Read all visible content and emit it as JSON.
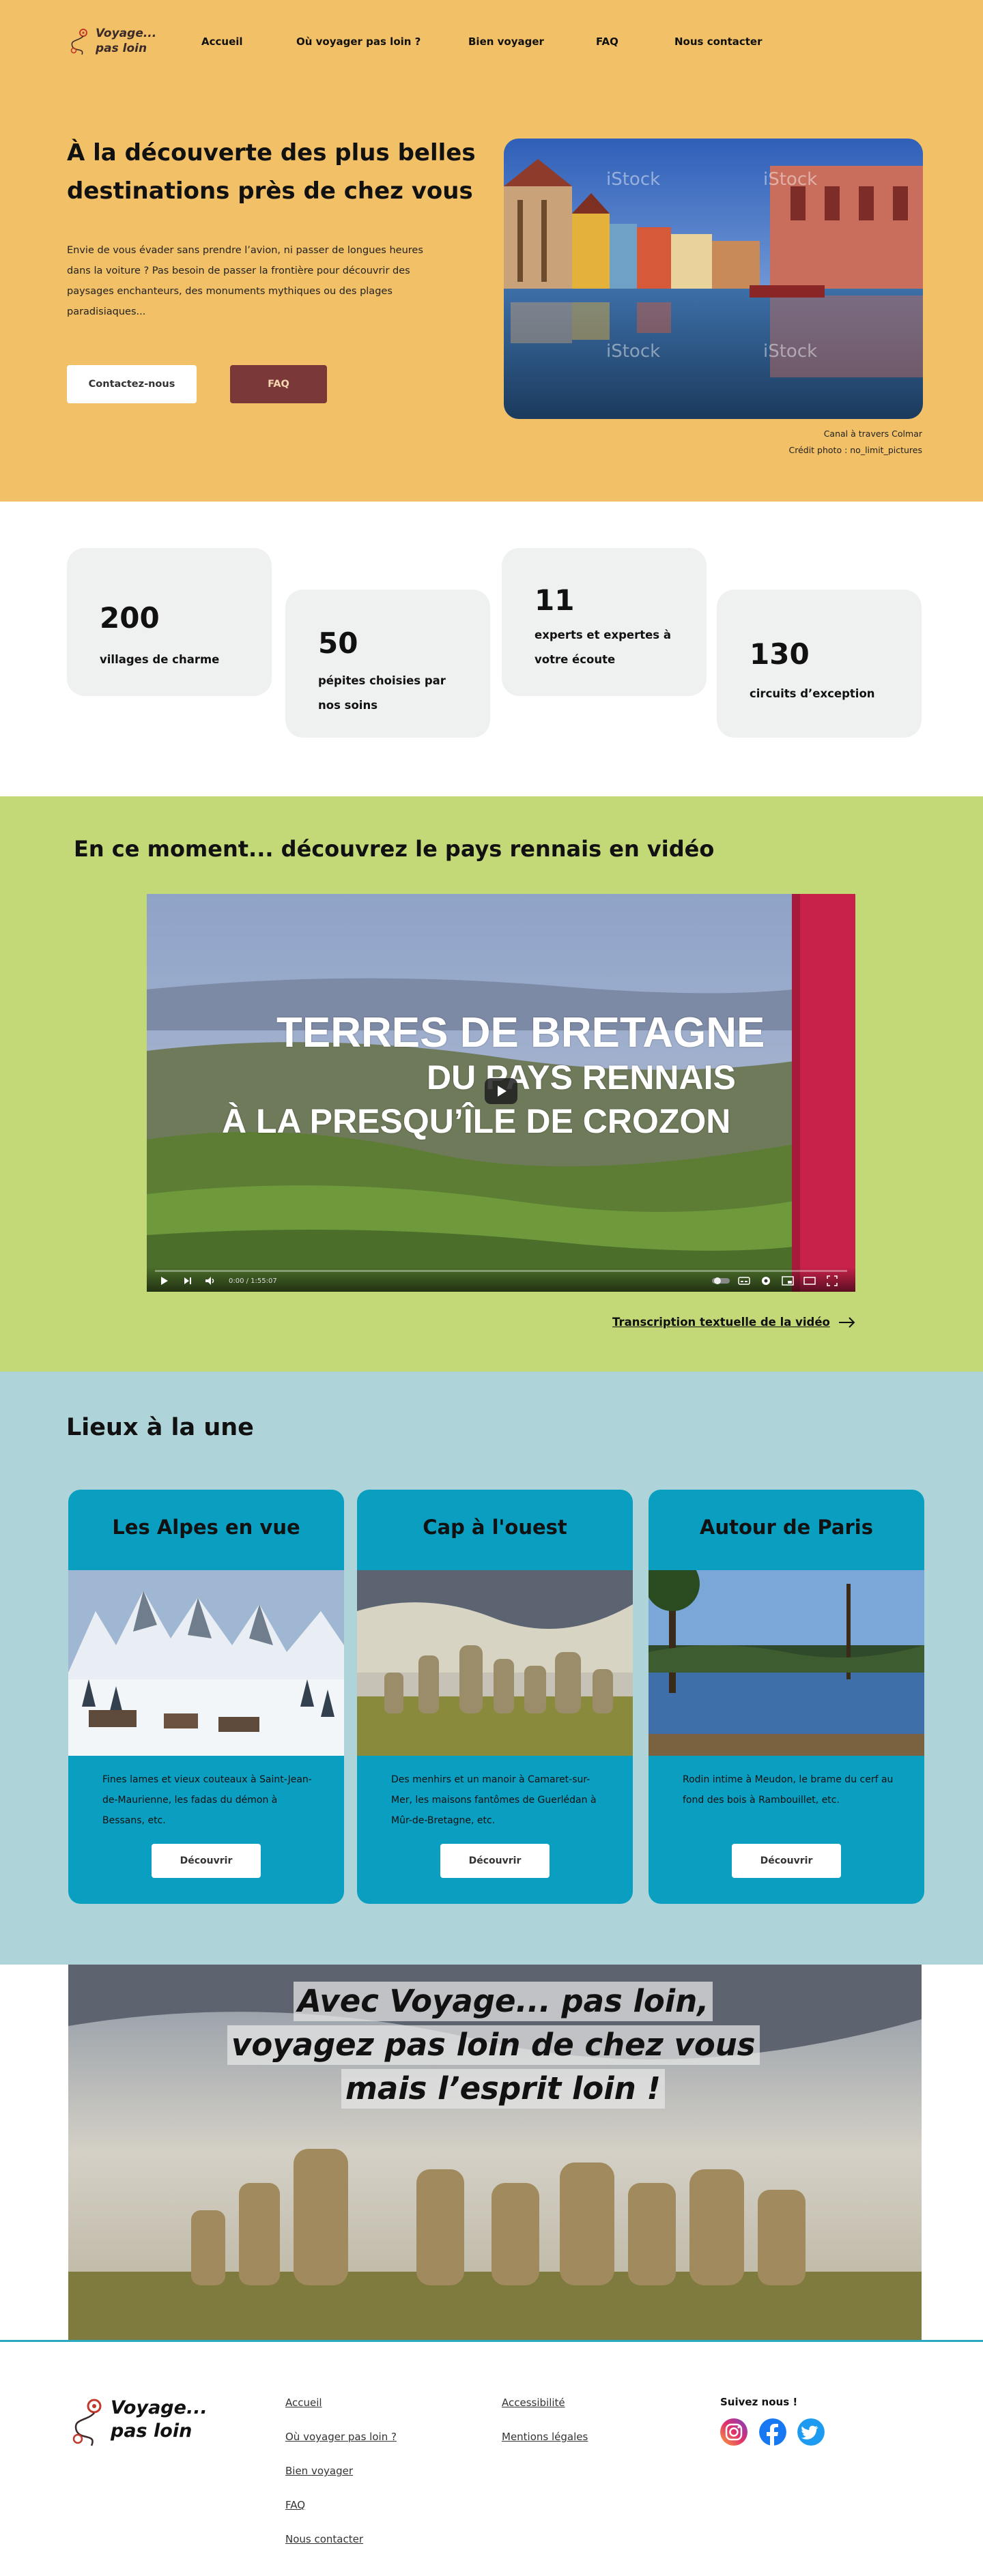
{
  "brand": {
    "line1": "Voyage...",
    "line2": "pas loin",
    "colors": {
      "hero_bg": "#f2c066",
      "accent_brown": "#7a3838",
      "video_bg": "#c3d978",
      "places_bg": "#aed4da",
      "card_bg": "#0a9ec1",
      "footer_line": "#27aac0"
    }
  },
  "nav": {
    "items": [
      "Accueil",
      "Où voyager pas loin ?",
      "Bien voyager",
      "FAQ",
      "Nous contacter"
    ]
  },
  "hero": {
    "title": "À la découverte des plus belles destinations près de chez vous",
    "text": "Envie de vous évader sans prendre l’avion, ni passer de longues heures dans la voiture ? Pas besoin de passer la frontière pour découvrir des paysages enchanteurs, des monuments mythiques ou des plages paradisiaques...",
    "btn_contact": "Contactez-nous",
    "btn_faq": "FAQ",
    "caption_line1": "Canal à travers Colmar",
    "caption_line2": "Crédit photo : no_limit_pictures",
    "watermark": "iStock"
  },
  "stats": [
    {
      "num": "200",
      "label": "villages de charme"
    },
    {
      "num": "50",
      "label": "pépites choisies par nos soins"
    },
    {
      "num": "11",
      "label": "experts et expertes à votre écoute"
    },
    {
      "num": "130",
      "label": "circuits d’exception"
    }
  ],
  "video": {
    "title": "En ce moment... découvrez le pays rennais en vidéo",
    "line1": "TERRES DE BRETAGNE",
    "line2": "DU PAYS RENNAIS",
    "line3": "À LA PRESQU’ÎLE DE CROZON",
    "time": "0:00 / 1:55:07",
    "transcript": "Transcription textuelle de la vidéo"
  },
  "places": {
    "title": "Lieux à la une",
    "cards": [
      {
        "title": "Les Alpes en vue",
        "text": "Fines lames et vieux couteaux à Saint-Jean-de-Maurienne, les fadas du démon à Bessans, etc.",
        "btn": "Découvrir"
      },
      {
        "title": "Cap à l'ouest",
        "text": "Des menhirs et un manoir à Camaret-sur-Mer, les maisons fantômes de Guerlédan à Mûr-de-Bretagne, etc.",
        "btn": "Découvrir"
      },
      {
        "title": "Autour de Paris",
        "text": "Rodin intime à Meudon, le brame du cerf au fond des bois à Rambouillet, etc.",
        "btn": "Découvrir"
      }
    ]
  },
  "banner": {
    "line1": "Avec Voyage... pas loin,",
    "line2": "voyagez pas loin de chez vous",
    "line3": "mais l’esprit loin !"
  },
  "footer": {
    "col1": [
      "Accueil",
      "Où voyager pas loin ?",
      "Bien voyager",
      "FAQ",
      "Nous contacter"
    ],
    "col2": [
      "Accessibilité",
      "Mentions légales"
    ],
    "follow": "Suivez nous !",
    "social_icons": [
      "instagram-icon",
      "facebook-icon",
      "twitter-icon"
    ]
  }
}
